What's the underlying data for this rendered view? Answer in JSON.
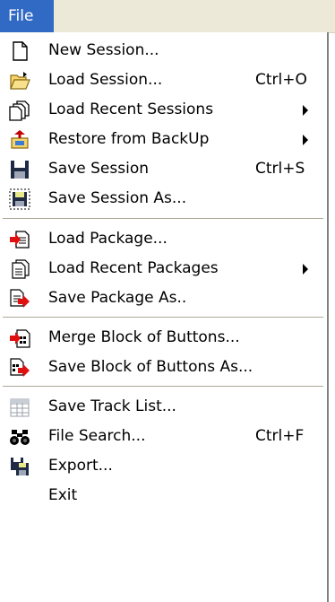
{
  "menubar": {
    "title": "File"
  },
  "menu": {
    "items": [
      {
        "label": "New Session...",
        "shortcut": "",
        "icon": "new-document-icon"
      },
      {
        "label": "Load Session...",
        "shortcut": "Ctrl+O",
        "icon": "open-folder-icon"
      },
      {
        "label": "Load Recent Sessions",
        "shortcut": "",
        "icon": "recent-documents-icon",
        "submenu": true
      },
      {
        "label": "Restore from BackUp",
        "shortcut": "",
        "icon": "restore-backup-icon",
        "submenu": true
      },
      {
        "label": "Save Session",
        "shortcut": "Ctrl+S",
        "icon": "floppy-disk-icon"
      },
      {
        "label": "Save Session As...",
        "shortcut": "",
        "icon": "save-as-icon"
      },
      {
        "label": "Load Package...",
        "shortcut": "",
        "icon": "load-package-icon"
      },
      {
        "label": "Load Recent Packages",
        "shortcut": "",
        "icon": "recent-packages-icon",
        "submenu": true
      },
      {
        "label": "Save Package As..",
        "shortcut": "",
        "icon": "save-package-icon"
      },
      {
        "label": "Merge Block of Buttons...",
        "shortcut": "",
        "icon": "merge-block-icon"
      },
      {
        "label": "Save Block of Buttons As...",
        "shortcut": "",
        "icon": "save-block-icon"
      },
      {
        "label": "Save Track List...",
        "shortcut": "",
        "icon": "track-list-icon"
      },
      {
        "label": "File Search...",
        "shortcut": "Ctrl+F",
        "icon": "binoculars-icon"
      },
      {
        "label": "Export...",
        "shortcut": "",
        "icon": "export-icon"
      },
      {
        "label": "Exit",
        "shortcut": "",
        "icon": ""
      }
    ]
  },
  "colors": {
    "highlight": "#316ac5",
    "menubar_bg": "#ece9d8",
    "separator": "#aca899"
  }
}
